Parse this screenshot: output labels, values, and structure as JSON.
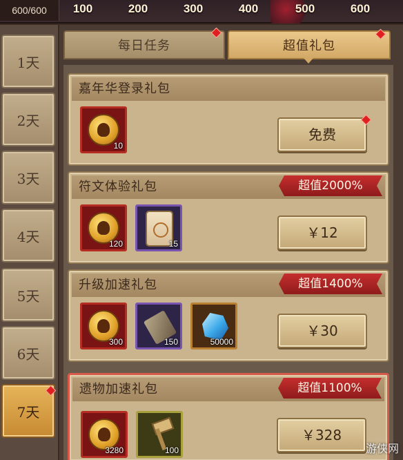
{
  "top_bar": {
    "progress": "600/600",
    "milestones": [
      "100",
      "200",
      "300",
      "400",
      "500",
      "600"
    ]
  },
  "days": [
    "1天",
    "2天",
    "3天",
    "4天",
    "5天",
    "6天",
    "7天"
  ],
  "tabs": {
    "daily": "每日任务",
    "value_pack": "超值礼包"
  },
  "packs": [
    {
      "title": "嘉年华登录礼包",
      "button": "免费",
      "items": [
        {
          "icon": "gold-coin-icon",
          "qty": "10"
        }
      ]
    },
    {
      "title": "符文体验礼包",
      "badge": "超值2000%",
      "button": "￥12",
      "items": [
        {
          "icon": "gold-coin-icon",
          "qty": "120"
        },
        {
          "icon": "rune-scroll-icon",
          "qty": "15"
        }
      ]
    },
    {
      "title": "升级加速礼包",
      "badge": "超值1400%",
      "button": "￥30",
      "items": [
        {
          "icon": "gold-coin-icon",
          "qty": "300"
        },
        {
          "icon": "speedup-tool-icon",
          "qty": "150"
        },
        {
          "icon": "crystal-icon",
          "qty": "50000"
        }
      ]
    },
    {
      "title": "遗物加速礼包",
      "badge": "超值1100%",
      "button": "￥328",
      "items": [
        {
          "icon": "gold-coin-icon",
          "qty": "3280"
        },
        {
          "icon": "hammer-icon",
          "qty": "100"
        }
      ]
    }
  ],
  "watermark": "游侠网",
  "colors": {
    "accent_red": "#e02020",
    "highlight_border": "#d85a4a",
    "badge_red": "#c52e2e"
  }
}
